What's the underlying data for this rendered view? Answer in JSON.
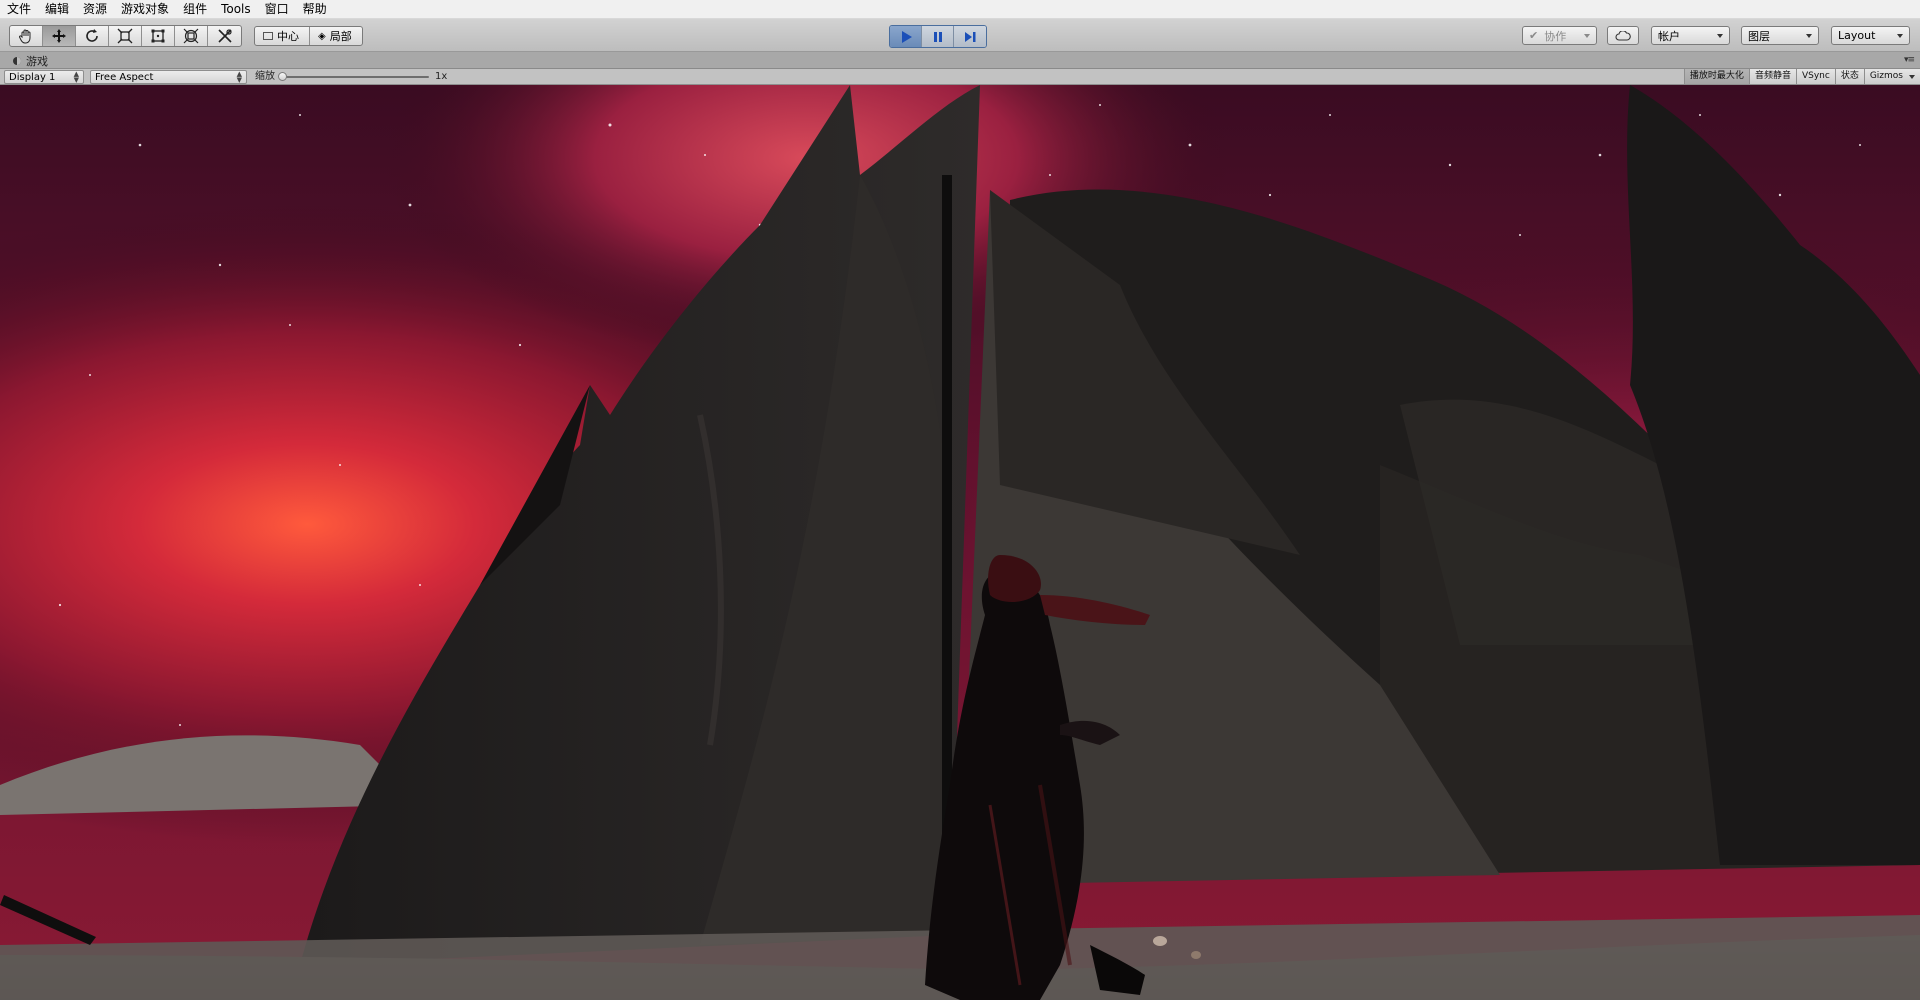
{
  "menubar": {
    "items": [
      "文件",
      "编辑",
      "资源",
      "游戏对象",
      "组件",
      "Tools",
      "窗口",
      "帮助"
    ]
  },
  "toolbar": {
    "tools": [
      {
        "icon": "hand-icon",
        "active": false
      },
      {
        "icon": "move-icon",
        "active": true
      },
      {
        "icon": "rotate-icon",
        "active": false
      },
      {
        "icon": "scale-icon",
        "active": false
      },
      {
        "icon": "rect-tool-icon",
        "active": false
      },
      {
        "icon": "transform-icon",
        "active": false
      },
      {
        "icon": "custom-tool-icon",
        "active": false
      }
    ],
    "pivot_label": "中心",
    "local_label": "局部",
    "playmode": {
      "playing": true
    },
    "collab_label": "协作",
    "account_label": "帐户",
    "layers_label": "图层",
    "layout_label": "Layout"
  },
  "tab": {
    "game_label": "游戏"
  },
  "gamebar": {
    "display_value": "Display 1",
    "aspect_value": "Free Aspect",
    "scale_label": "缩放",
    "scale_value": "1x",
    "scale_fraction": 0.0,
    "maximize_label": "播放时最大化",
    "mute_label": "音频静音",
    "vsync_label": "VSync",
    "stats_label": "状态",
    "gizmos_label": "Gizmos"
  },
  "colors": {
    "menubar_bg": "#f0f0f0",
    "toolbar_bg": "#c8c8c8",
    "play_active": "#6a8bb8",
    "sky_red": "#c0283a",
    "ground": "#5a5652"
  }
}
